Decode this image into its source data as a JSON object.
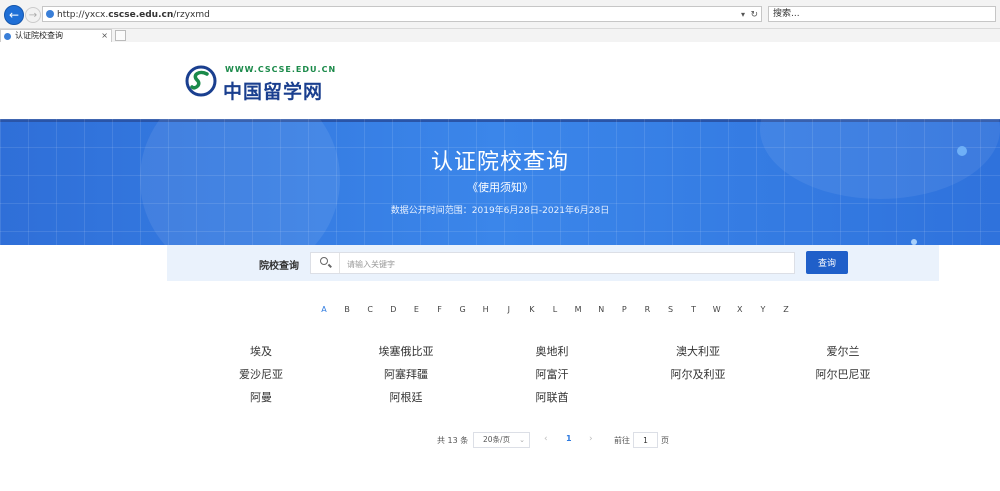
{
  "browser": {
    "url_prefix": "http://yxcx.",
    "url_domain": "cscse.edu.cn",
    "url_suffix": "/rzyxmd",
    "search_placeholder": "搜索...",
    "tab_title": "认证院校查询",
    "back_icon": "←",
    "forward_icon": "→",
    "dropdown_icon": "▾",
    "refresh_icon": "↻",
    "close_icon": "×"
  },
  "logo": {
    "url_text": "WWW.CSCSE.EDU.CN",
    "name": "中国留学网",
    "colors": {
      "green": "#1b8a4a",
      "blue": "#1a3f8f"
    }
  },
  "banner": {
    "title": "认证院校查询",
    "notice_link": "《使用须知》",
    "date_range": "数据公开时间范围：2019年6月28日-2021年6月28日"
  },
  "search": {
    "label": "院校查询",
    "placeholder": "请输入关键字",
    "button": "查询"
  },
  "alphabet": {
    "letters": [
      "A",
      "B",
      "C",
      "D",
      "E",
      "F",
      "G",
      "H",
      "J",
      "K",
      "L",
      "M",
      "N",
      "P",
      "R",
      "S",
      "T",
      "W",
      "X",
      "Y",
      "Z"
    ],
    "active": "A"
  },
  "countries": [
    "埃及",
    "埃塞俄比亚",
    "奥地利",
    "澳大利亚",
    "爱尔兰",
    "爱沙尼亚",
    "阿塞拜疆",
    "阿富汗",
    "阿尔及利亚",
    "阿尔巴尼亚",
    "阿曼",
    "阿根廷",
    "阿联酋"
  ],
  "pagination": {
    "total": "共 13 条",
    "page_size": "20条/页",
    "prev": "‹",
    "current": "1",
    "next": "›",
    "goto_label": "前往",
    "goto_value": "1",
    "page_label": "页"
  },
  "colors": {
    "accent": "#1f5fc9",
    "banner": "#3b86ea",
    "active_link": "#2f7be0"
  }
}
